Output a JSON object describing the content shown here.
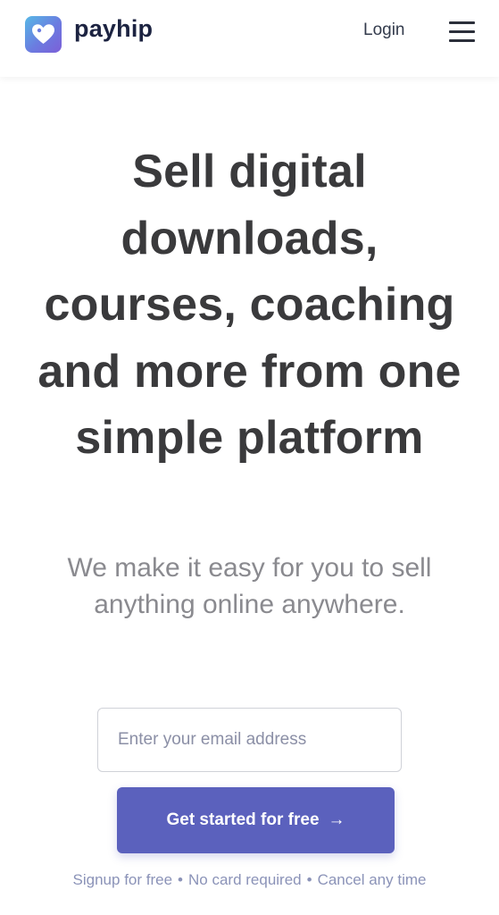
{
  "brand": {
    "name": "payhip",
    "logo_icon": "heart-tag-icon",
    "colors": {
      "gradient_start": "#57b8e6",
      "gradient_end": "#7c5fd8",
      "text": "#1c2341"
    }
  },
  "nav": {
    "login_label": "Login",
    "menu_icon": "hamburger-menu-icon"
  },
  "hero": {
    "title": "Sell digital downloads, courses, coaching and more from one simple platform",
    "subtitle": "We make it easy for you to sell anything online anywhere."
  },
  "signup": {
    "email_placeholder": "Enter your email address",
    "cta_label": "Get started for free",
    "cta_arrow": "→",
    "cta_color": "#5b61bd",
    "trust_items": [
      "Signup for free",
      "No card required",
      "Cancel any time"
    ]
  }
}
